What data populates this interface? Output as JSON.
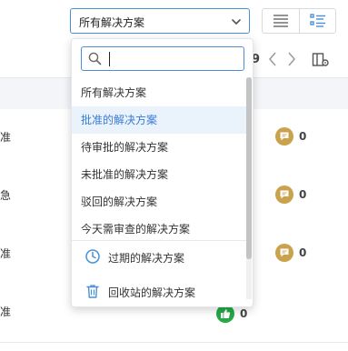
{
  "filter": {
    "selected": "所有解决方案"
  },
  "pager": {
    "count_fragment": "9"
  },
  "rows": [
    {
      "text_fragment": "准",
      "badge": {
        "kind": "comment",
        "icon": "comment-icon",
        "color": "#c9a24b",
        "count": "0"
      }
    },
    {
      "text_fragment": "急",
      "badge": {
        "kind": "comment",
        "icon": "comment-icon",
        "color": "#c9a24b",
        "count": "0"
      }
    },
    {
      "text_fragment": "准",
      "badge": {
        "kind": "comment",
        "icon": "comment-icon",
        "color": "#c9a24b",
        "count": "0"
      }
    },
    {
      "text_fragment": "准",
      "badge": {
        "kind": "approve",
        "icon": "thumbs-up-icon",
        "color": "#27a745",
        "count": "0"
      }
    }
  ],
  "dropdown": {
    "search_value": "",
    "items": [
      {
        "label": "所有解决方案",
        "active": false
      },
      {
        "label": "批准的解决方案",
        "active": true
      },
      {
        "label": "待审批的解决方案",
        "active": false
      },
      {
        "label": "未批准的解决方案",
        "active": false
      },
      {
        "label": "驳回的解决方案",
        "active": false
      },
      {
        "label": "今天需审查的解决方案",
        "active": false
      }
    ],
    "expired": {
      "label": "过期的解决方案",
      "icon": "clock-icon"
    },
    "trash": {
      "label": "回收站的解决方案",
      "icon": "trash-icon"
    }
  },
  "colors": {
    "accent": "#4a90d9",
    "active_text": "#3a7bd5",
    "comment_badge": "#c9a24b",
    "approve_badge": "#27a745"
  }
}
